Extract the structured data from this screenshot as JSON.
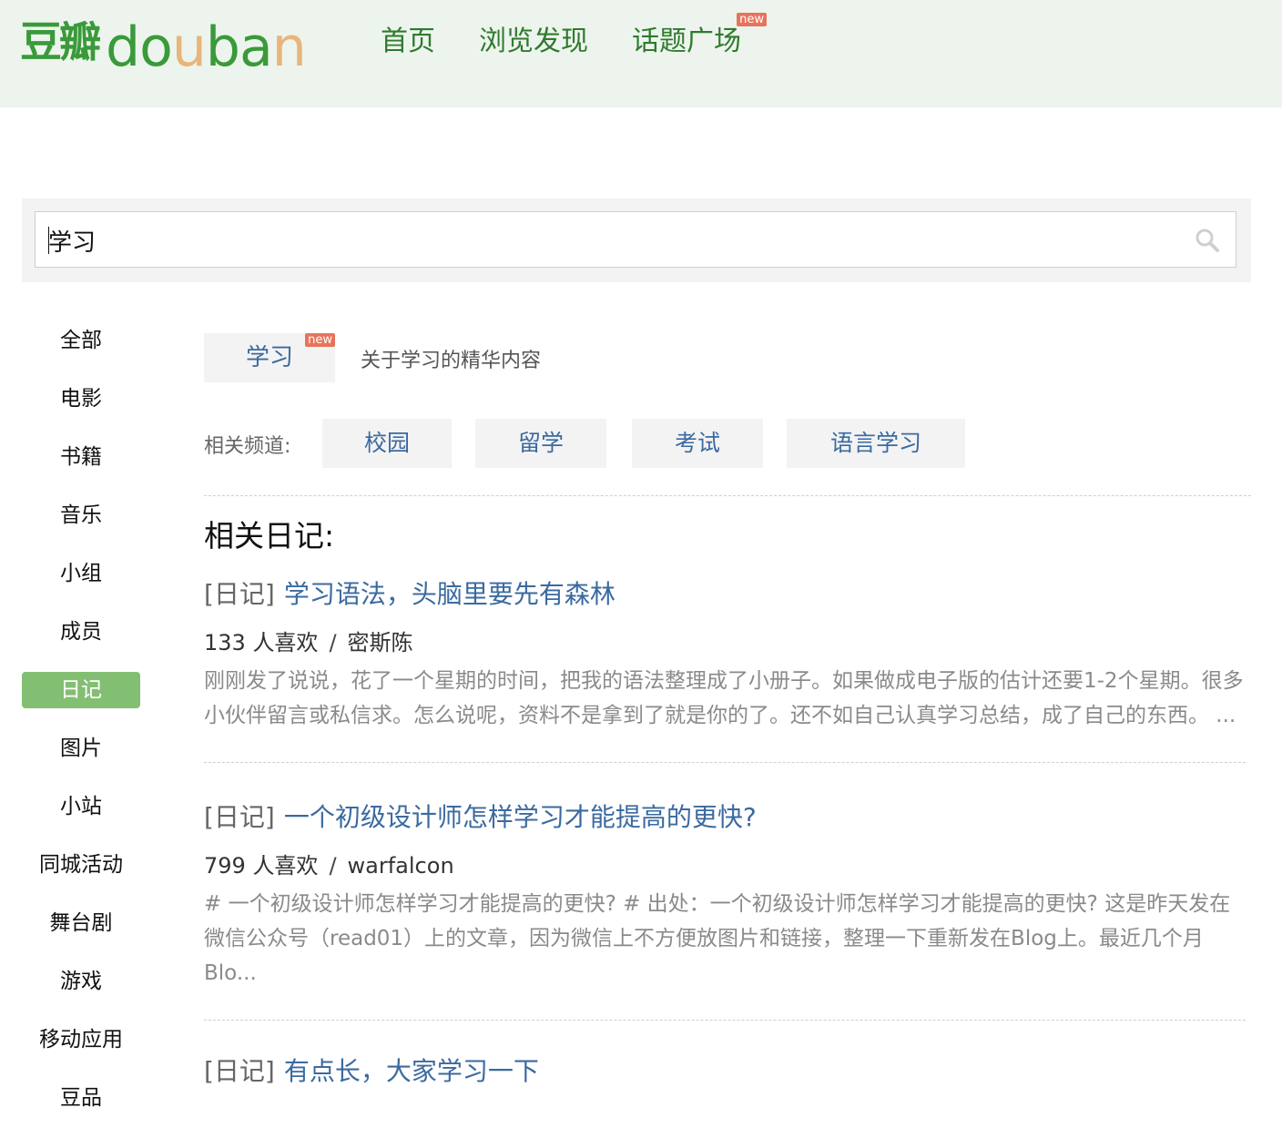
{
  "header": {
    "logo_cn": "豆瓣",
    "logo_en": [
      "d",
      "o",
      "u",
      "b",
      "a",
      "n"
    ],
    "nav": [
      {
        "label": "首页"
      },
      {
        "label": "浏览发现"
      },
      {
        "label": "话题广场",
        "badge": "new"
      }
    ]
  },
  "search": {
    "value": "学习"
  },
  "sidebar": {
    "items": [
      {
        "label": "全部"
      },
      {
        "label": "电影"
      },
      {
        "label": "书籍"
      },
      {
        "label": "音乐"
      },
      {
        "label": "小组"
      },
      {
        "label": "成员"
      },
      {
        "label": "日记",
        "active": true
      },
      {
        "label": "图片"
      },
      {
        "label": "小站"
      },
      {
        "label": "同城活动"
      },
      {
        "label": "舞台剧"
      },
      {
        "label": "游戏"
      },
      {
        "label": "移动应用"
      },
      {
        "label": "豆品"
      }
    ]
  },
  "topic": {
    "label": "学习",
    "badge": "new",
    "description": "关于学习的精华内容"
  },
  "channels": {
    "label": "相关频道:",
    "items": [
      {
        "label": "校园"
      },
      {
        "label": "留学"
      },
      {
        "label": "考试"
      },
      {
        "label": "语言学习"
      }
    ]
  },
  "section_title": "相关日记:",
  "entries": [
    {
      "kind": "[日记]",
      "title": "学习语法，头脑里要先有森林",
      "likes": "133 人喜欢",
      "sep": "/",
      "author": "密斯陈",
      "excerpt": "刚刚发了说说，花了一个星期的时间，把我的语法整理成了小册子。如果做成电子版的估计还要1-2个星期。很多小伙伴留言或私信求。怎么说呢，资料不是拿到了就是你的了。还不如自己认真学习总结，成了自己的东西。 ..."
    },
    {
      "kind": "[日记]",
      "title": "一个初级设计师怎样学习才能提高的更快?",
      "likes": "799 人喜欢",
      "sep": "/",
      "author": "warfalcon",
      "excerpt": "# 一个初级设计师怎样学习才能提高的更快? # 出处：一个初级设计师怎样学习才能提高的更快? 这是昨天发在微信公众号（read01）上的文章，因为微信上不方便放图片和链接，整理一下重新发在Blog上。最近几个月Blo..."
    },
    {
      "kind": "[日记]",
      "title": "有点长，大家学习一下"
    }
  ]
}
